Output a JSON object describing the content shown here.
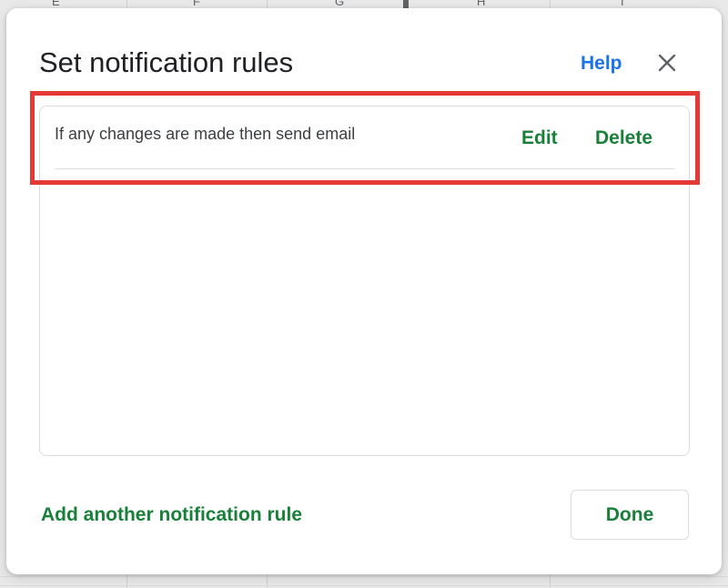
{
  "spreadsheet": {
    "column_letters": [
      "E",
      "F",
      "G",
      "H",
      "I"
    ]
  },
  "dialog": {
    "title": "Set notification rules",
    "help_label": "Help",
    "close_icon": "close-icon",
    "rules": [
      {
        "description": "If any changes are made then send email",
        "edit_label": "Edit",
        "delete_label": "Delete"
      }
    ],
    "add_rule_label": "Add another notification rule",
    "done_label": "Done"
  },
  "colors": {
    "accent_green": "#188038",
    "link_blue": "#1a73e8",
    "highlight_red": "#e53935"
  }
}
